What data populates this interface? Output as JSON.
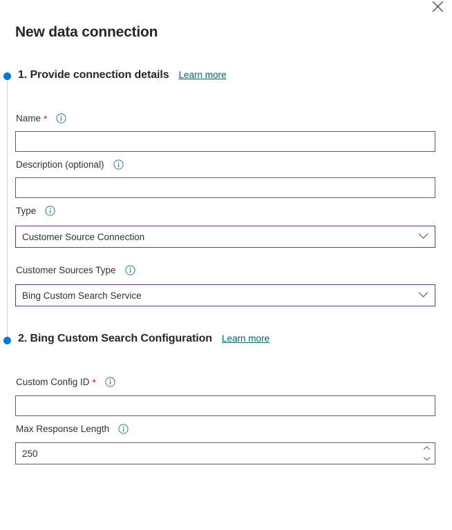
{
  "panel": {
    "title": "New data connection",
    "close_label": "Close"
  },
  "sections": [
    {
      "title": "1. Provide connection details",
      "learn_more": "Learn more"
    },
    {
      "title": "2. Bing Custom Search Configuration",
      "learn_more": "Learn more"
    }
  ],
  "fields": {
    "name": {
      "label": "Name",
      "required_mark": "*",
      "value": "",
      "placeholder": ""
    },
    "description": {
      "label": "Description (optional)",
      "value": "",
      "placeholder": ""
    },
    "type": {
      "label": "Type",
      "value": "Customer Source Connection"
    },
    "customer_sources_type": {
      "label": "Customer Sources Type",
      "value": "Bing Custom Search Service"
    },
    "custom_config_id": {
      "label": "Custom Config ID",
      "required_mark": "*",
      "value": "",
      "placeholder": ""
    },
    "max_response_length": {
      "label": "Max Response Length",
      "value": "250"
    }
  },
  "icons": {
    "info": "info-icon",
    "close": "close-icon",
    "chevron_down": "chevron-down-icon",
    "chevron_up": "chevron-up-icon"
  },
  "colors": {
    "accent_blue": "#0078d4",
    "focus_purple": "#6b2f90",
    "link_teal": "#00606e",
    "required_red": "#a4262c",
    "info_teal": "#2b7a94",
    "border_gray": "#605e5c",
    "rail_gray": "#d6d6d6",
    "text_dark": "#262626"
  }
}
